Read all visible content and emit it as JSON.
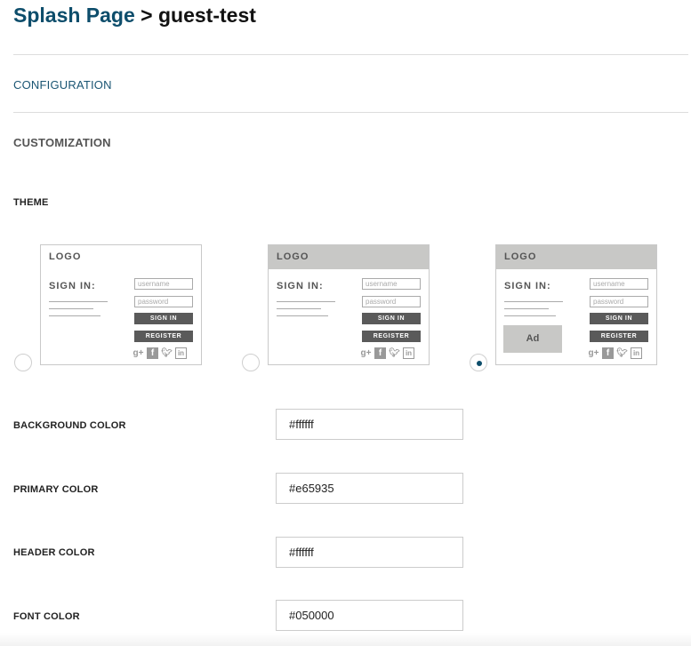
{
  "header": {
    "breadcrumb_link": "Splash Page",
    "separator": ">",
    "current": "guest-test"
  },
  "sections": {
    "configuration": "CONFIGURATION",
    "customization": "CUSTOMIZATION"
  },
  "theme": {
    "label": "THEME",
    "selected_index": 2,
    "preview_text": {
      "logo": "LOGO",
      "sign_in": "SIGN IN:",
      "username_placeholder": "username",
      "password_placeholder": "password",
      "sign_in_button": "SIGN IN",
      "register_button": "REGISTER",
      "ad": "Ad"
    },
    "social_icons": [
      "google-plus-icon",
      "facebook-icon",
      "twitter-icon",
      "linkedin-icon"
    ]
  },
  "colors": {
    "background": {
      "label": "BACKGROUND COLOR",
      "value": "#ffffff"
    },
    "primary": {
      "label": "PRIMARY COLOR",
      "value": "#e65935"
    },
    "header": {
      "label": "HEADER COLOR",
      "value": "#ffffff"
    },
    "font": {
      "label": "FONT COLOR",
      "value": "#050000"
    }
  },
  "style": {
    "accent": "#0d4d6b",
    "preview_button": "#5a5a5a",
    "preview_header": "#c8c8c6"
  }
}
